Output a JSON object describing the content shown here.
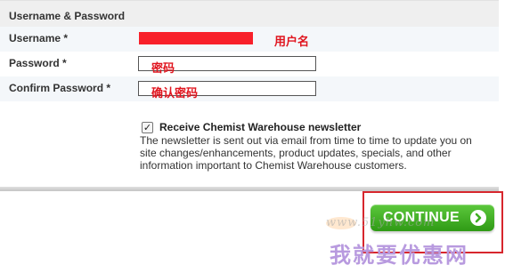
{
  "form": {
    "section_title": "Username & Password",
    "username_label": "Username *",
    "password_label": "Password *",
    "confirm_label": "Confirm Password *",
    "annotation_username": "用户名",
    "annotation_password": "密码",
    "annotation_confirm": "确认密码"
  },
  "newsletter": {
    "checked": true,
    "checkbox_glyph": "✓",
    "label": "Receive Chemist Warehouse newsletter",
    "description": "The newsletter is sent out via email from time to time to update you on site changes/enhancements, product updates, specials, and other information important to Chemist Warehouse customers."
  },
  "actions": {
    "continue_label": "CONTINUE",
    "continue_icon": "arrow-right-icon"
  },
  "watermark": {
    "url": "www.51yhw.com",
    "brand": "我就要优惠网"
  },
  "colors": {
    "redaction": "#f8202a",
    "annotation": "#e0141e",
    "button_green": "#3fae22",
    "highlight_border": "#d7262d"
  }
}
